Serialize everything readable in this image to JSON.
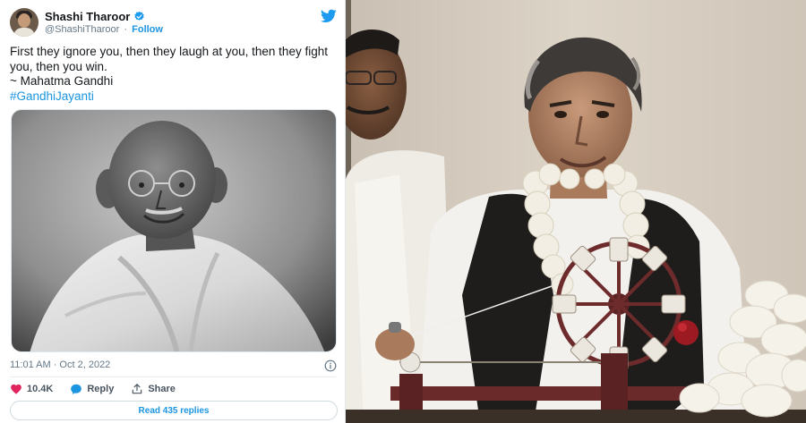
{
  "tweet": {
    "author_name": "Shashi Tharoor",
    "handle": "@ShashiTharoor",
    "separator": "·",
    "follow_label": "Follow",
    "text_lines": [
      "First they ignore you, then they laugh at you, then they fight",
      "you, then you win.",
      "~ Mahatma Gandhi"
    ],
    "hashtag": "#GandhiJayanti",
    "timestamp": "11:01 AM · Oct 2, 2022",
    "likes_count": "10.4K",
    "reply_label": "Reply",
    "share_label": "Share",
    "read_replies_label": "Read 435 replies"
  },
  "icons": {
    "verified": "verified-badge-icon",
    "twitter": "twitter-bird-icon",
    "info": "info-icon",
    "like": "heart-icon",
    "reply": "reply-bubble-icon",
    "share": "share-upload-icon"
  },
  "colors": {
    "twitter_blue": "#1b95e0",
    "like_red": "#e0245e",
    "text": "#14171a",
    "muted": "#657786"
  }
}
